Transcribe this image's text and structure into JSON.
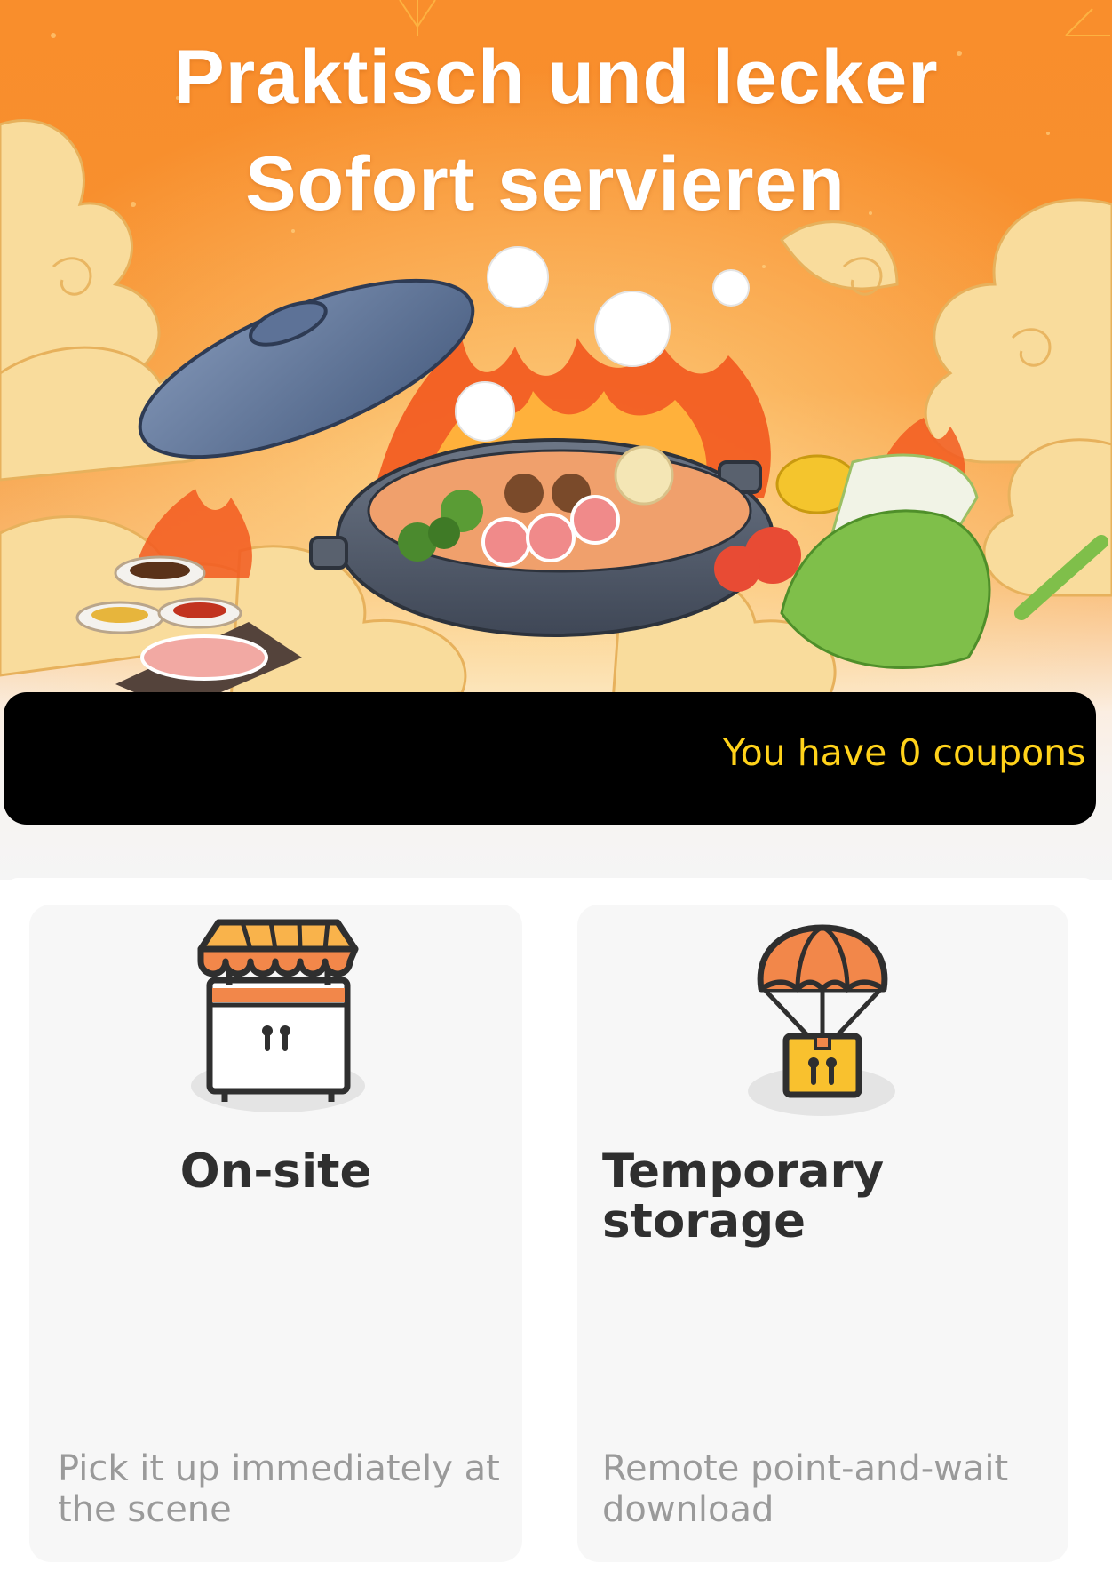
{
  "banner": {
    "title_line_1": "Praktisch und lecker",
    "title_line_2": "Sofort servieren",
    "illustration": "hot-pot-illustration",
    "colors": {
      "background": "#f98e2c",
      "title": "#ffffff"
    }
  },
  "coupon_bar": {
    "text": "You have 0 coupons",
    "colors": {
      "background": "#000000",
      "text": "#ffd21a"
    }
  },
  "options": [
    {
      "title": "On-site",
      "description": "Pick it up immediately at the scene",
      "icon": "food-stall-icon"
    },
    {
      "title": "Temporary storage",
      "description": "Remote point-and-wait download",
      "icon": "parachute-box-icon"
    }
  ],
  "colors": {
    "accent": "#f5874a",
    "card_background": "#f7f7f7",
    "title_text": "#2f2f2f",
    "description_text": "#9a9a9a"
  }
}
